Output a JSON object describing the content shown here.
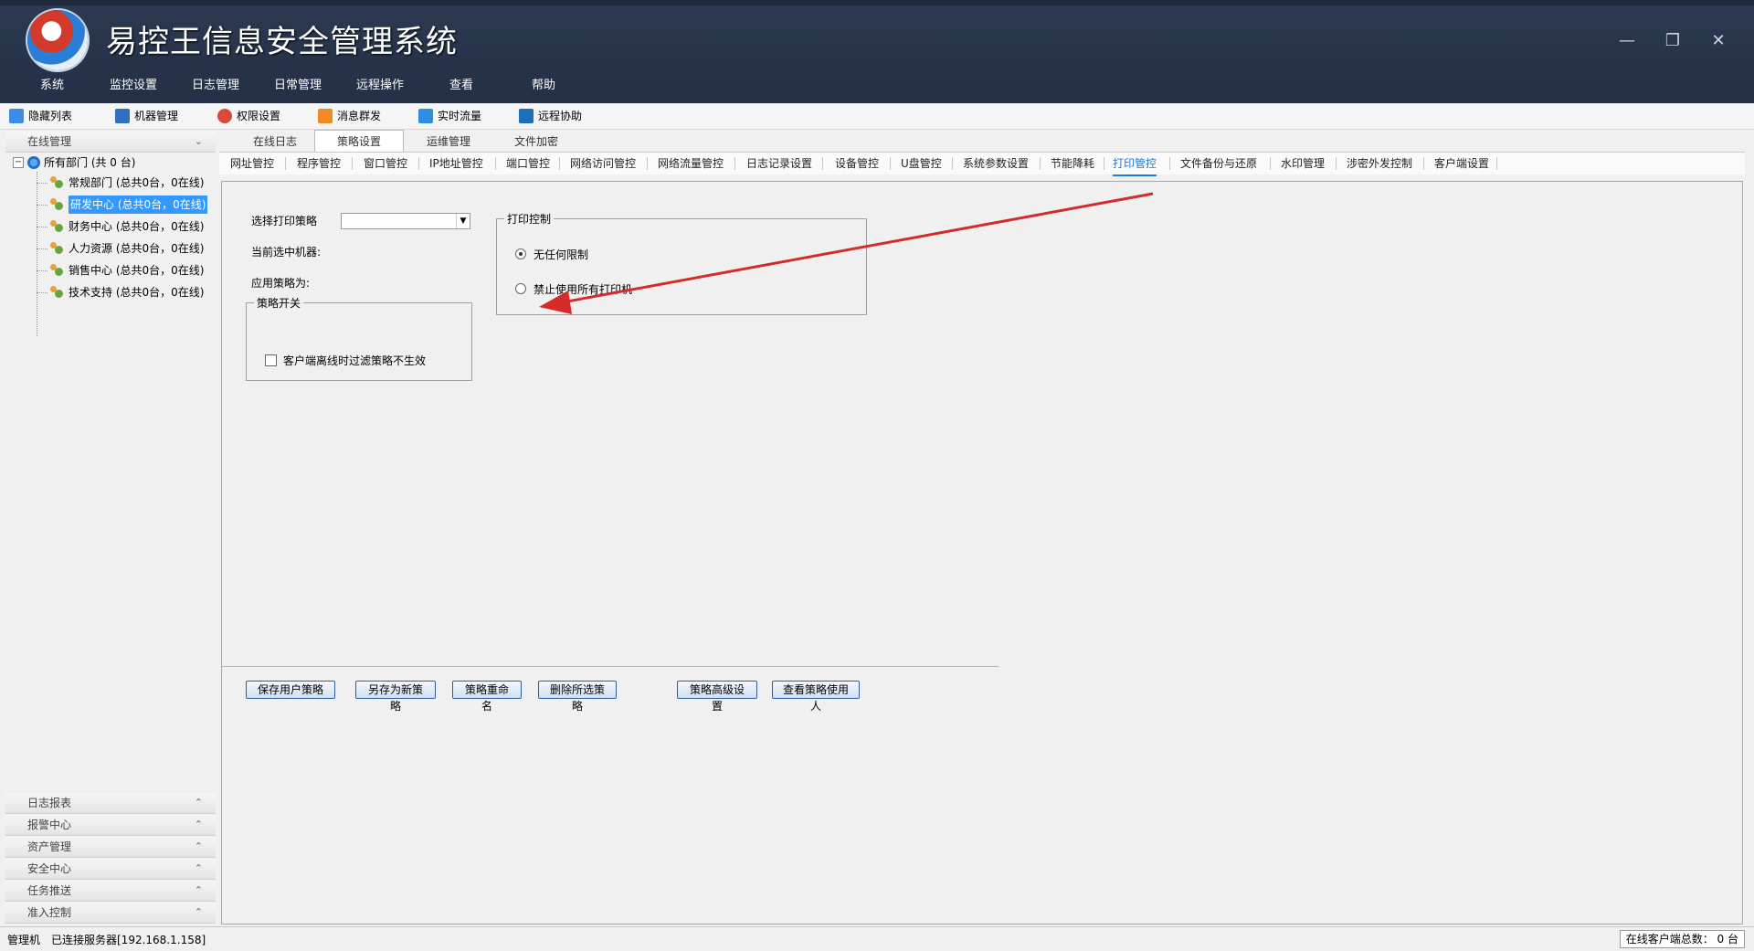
{
  "app": {
    "title": "易控王信息安全管理系统"
  },
  "window_controls": {
    "minimize": "—",
    "restore": "❐",
    "close": "✕"
  },
  "menu": [
    "系统",
    "监控设置",
    "日志管理",
    "日常管理",
    "远程操作",
    "查看",
    "帮助"
  ],
  "toolbar": [
    "隐藏列表",
    "机器管理",
    "权限设置",
    "消息群发",
    "实时流量",
    "远程协助"
  ],
  "sidebar": {
    "top_header": "在线管理",
    "root": "所有部门 (共 0 台)",
    "departments": [
      "常规部门 (总共0台，0在线)",
      "研发中心 (总共0台，0在线)",
      "财务中心 (总共0台，0在线)",
      "人力资源 (总共0台，0在线)",
      "销售中心 (总共0台，0在线)",
      "技术支持 (总共0台，0在线)"
    ],
    "bottom_headers": [
      "日志报表",
      "报警中心",
      "资产管理",
      "安全中心",
      "任务推送",
      "准入控制"
    ]
  },
  "main_tabs": [
    "在线日志",
    "策略设置",
    "运维管理",
    "文件加密"
  ],
  "sub_tabs": [
    "网址管控",
    "程序管控",
    "窗口管控",
    "IP地址管控",
    "端口管控",
    "网络访问管控",
    "网络流量管控",
    "日志记录设置",
    "设备管控",
    "U盘管控",
    "系统参数设置",
    "节能降耗",
    "打印管控",
    "文件备份与还原",
    "水印管理",
    "涉密外发控制",
    "客户端设置"
  ],
  "form": {
    "select_policy_label": "选择打印策略",
    "current_machine_label": "当前选中机器:",
    "apply_policy_label": "应用策略为:",
    "switch_group_title": "策略开关",
    "checkbox_label": "客户端离线时过滤策略不生效",
    "print_group_title": "打印控制",
    "radio_no_limit": "无任何限制",
    "radio_forbid_all": "禁止使用所有打印机"
  },
  "buttons": [
    "保存用户策略",
    "另存为新策略",
    "策略重命名",
    "删除所选策略",
    "策略高级设置",
    "查看策略使用人"
  ],
  "status": {
    "left": "管理机",
    "server": "已连接服务器[192.168.1.158]",
    "right": "在线客户端总数：  0 台"
  }
}
